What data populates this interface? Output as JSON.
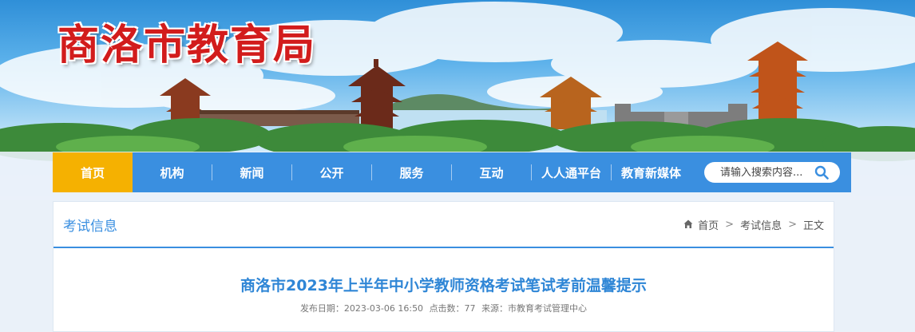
{
  "site": {
    "title": "商洛市教育局"
  },
  "nav": {
    "items": [
      {
        "label": "首页",
        "active": true
      },
      {
        "label": "机构"
      },
      {
        "label": "新闻"
      },
      {
        "label": "公开"
      },
      {
        "label": "服务"
      },
      {
        "label": "互动"
      },
      {
        "label": "人人通平台"
      },
      {
        "label": "教育新媒体"
      }
    ],
    "search_placeholder": "请输入搜索内容..."
  },
  "section": {
    "title": "考试信息"
  },
  "breadcrumb": {
    "home": "首页",
    "section": "考试信息",
    "current": "正文",
    "separator": ">"
  },
  "article": {
    "title": "商洛市2023年上半年中小学教师资格考试笔试考前温馨提示",
    "date": "发布日期：2023-03-06 16:50",
    "clicks": "点击数：77",
    "source": "来源：市教育考试管理中心"
  },
  "colors": {
    "nav_bg": "#3a8fe0",
    "nav_active": "#f5b101",
    "title_red": "#d21c1c",
    "accent_blue": "#2f86d6"
  },
  "icons": {
    "search": "search-icon",
    "home": "home-icon"
  }
}
